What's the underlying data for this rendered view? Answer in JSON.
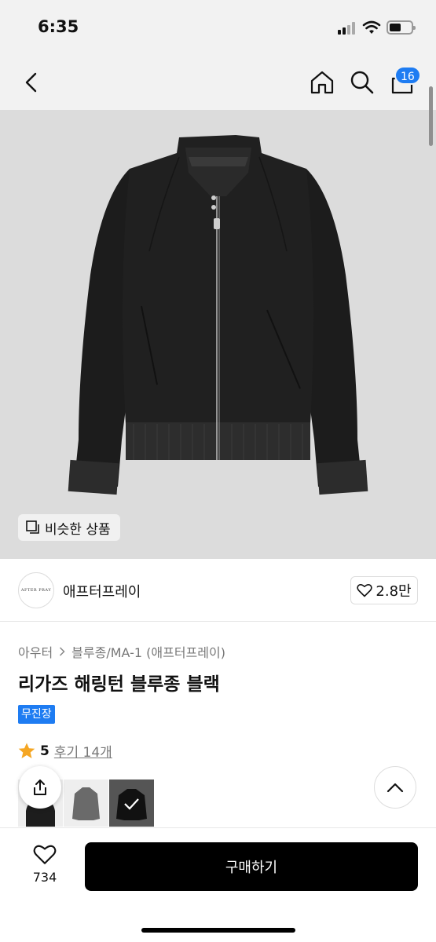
{
  "status": {
    "time": "6:35"
  },
  "header": {
    "cart_count": "16",
    "icons": [
      "back-icon",
      "home-icon",
      "search-icon",
      "cart-icon"
    ]
  },
  "hero": {
    "similar_label": "비슷한 상품",
    "jacket_label": "AFTER PRAY"
  },
  "brand": {
    "logo_text": "AFTER PRAY",
    "name": "애프터프레이",
    "likes": "2.8만"
  },
  "breadcrumb": [
    "아우터",
    "블루종/MA-1 (애프터프레이)"
  ],
  "product": {
    "title": "리가즈 해링턴 블루종 블랙",
    "badge": "무진장",
    "rating": "5",
    "reviews": "후기 14개"
  },
  "footer": {
    "wish_count": "734",
    "buy_label": "구매하기"
  },
  "colors": {
    "accent": "#1e7cf2",
    "buy": "#000000",
    "star": "#f5a623"
  }
}
